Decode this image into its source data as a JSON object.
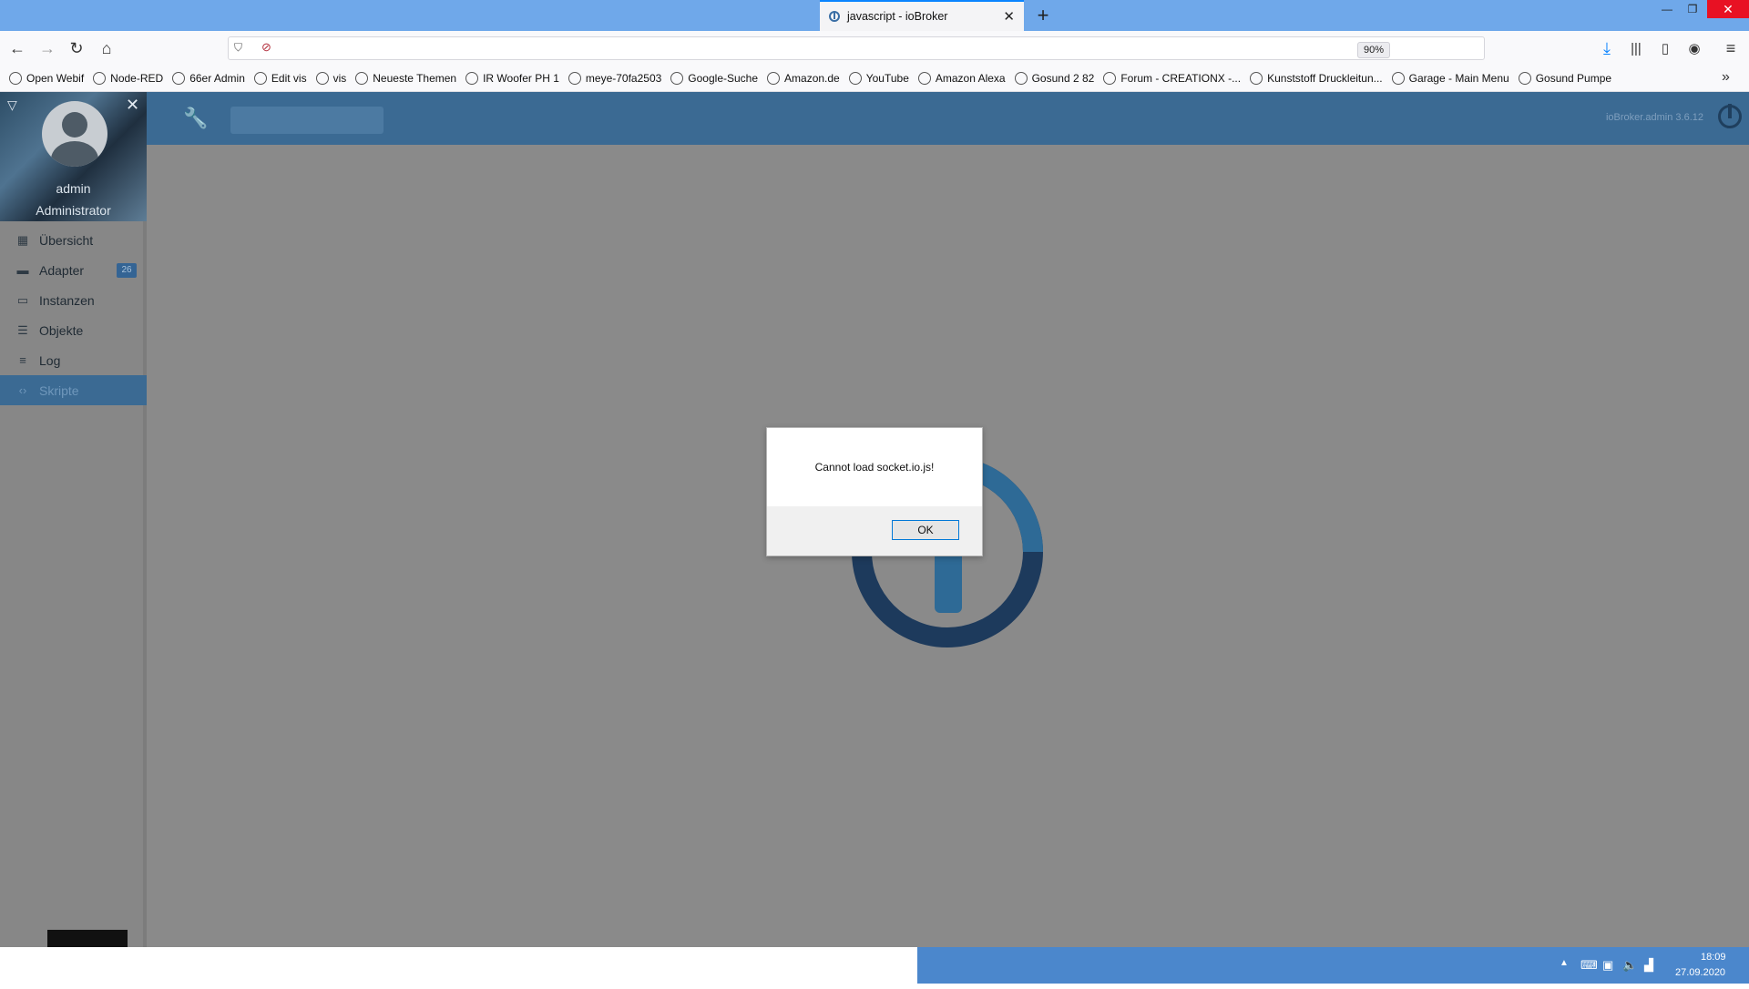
{
  "browser": {
    "tab_title": "javascript - ioBroker",
    "zoom": "90%",
    "url": ""
  },
  "bookmarks": [
    {
      "label": "Open Webif",
      "icon": "webif-icon"
    },
    {
      "label": "Node-RED",
      "icon": "globe-icon"
    },
    {
      "label": "66er Admin",
      "icon": "globe-icon"
    },
    {
      "label": "Edit vis",
      "icon": "vis-icon"
    },
    {
      "label": "vis",
      "icon": "vis-icon"
    },
    {
      "label": "Neueste Themen",
      "icon": "iobroker-icon"
    },
    {
      "label": "IR Woofer PH 1",
      "icon": "globe-icon"
    },
    {
      "label": "meye-70fa2503",
      "icon": "camera-icon"
    },
    {
      "label": "Google-Suche",
      "icon": "google-icon"
    },
    {
      "label": "Amazon.de",
      "icon": "amazon-icon"
    },
    {
      "label": "YouTube",
      "icon": "youtube-icon"
    },
    {
      "label": "Amazon Alexa",
      "icon": "alexa-icon"
    },
    {
      "label": "Gosund 2  82",
      "icon": "globe-icon"
    },
    {
      "label": "Forum - CREATIONX -...",
      "icon": "forum-icon"
    },
    {
      "label": "Kunststoff Druckleitun...",
      "icon": "star-icon"
    },
    {
      "label": "Garage - Main Menu",
      "icon": "globe-icon"
    },
    {
      "label": "Gosund Pumpe",
      "icon": "globe-icon"
    }
  ],
  "app": {
    "version": "ioBroker.admin 3.6.12",
    "user": {
      "name": "admin",
      "role": "Administrator"
    },
    "nav": [
      {
        "label": "Übersicht",
        "icon": "grid-icon"
      },
      {
        "label": "Adapter",
        "icon": "store-icon",
        "badge": "26"
      },
      {
        "label": "Instanzen",
        "icon": "instances-icon"
      },
      {
        "label": "Objekte",
        "icon": "list-icon"
      },
      {
        "label": "Log",
        "icon": "log-icon"
      },
      {
        "label": "Skripte",
        "icon": "code-icon",
        "active": true
      }
    ]
  },
  "dialog": {
    "message": "Cannot load socket.io.js!",
    "ok_label": "OK"
  },
  "taskbar": {
    "time": "18:09",
    "date": "27.09.2020"
  },
  "colors": {
    "accent": "#3b6a93",
    "overlay": "#8a8a8a",
    "taskbar": "#4b87cc",
    "logo_dark": "#1d3a5c",
    "logo_light": "#2e6a96"
  }
}
